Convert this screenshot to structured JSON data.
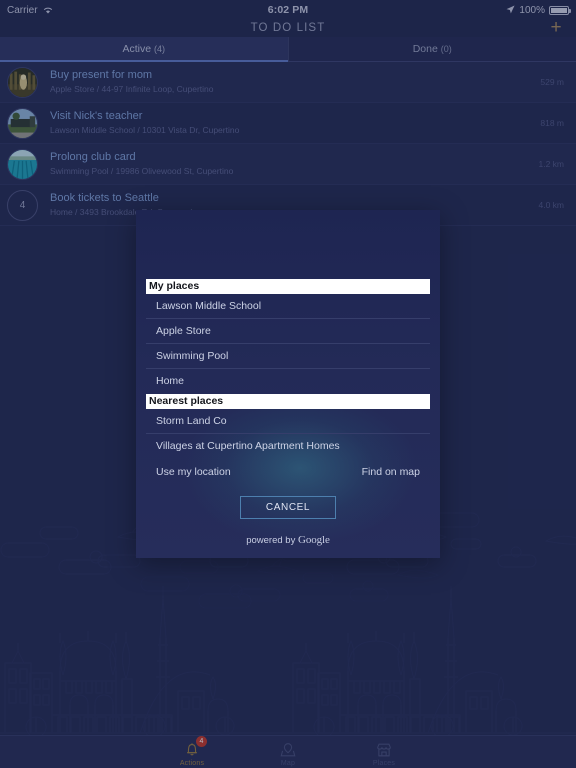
{
  "statusbar": {
    "carrier": "Carrier",
    "wifi_icon": "wifi-icon",
    "time": "6:02 PM",
    "location_icon": "location-arrow-icon",
    "battery_percent": "100%",
    "battery_icon": "battery-icon"
  },
  "navbar": {
    "title": "TO DO LIST",
    "add_label": "+"
  },
  "segments": [
    {
      "label": "Active",
      "count": "(4)",
      "selected": true
    },
    {
      "label": "Done",
      "count": "(0)",
      "selected": false
    }
  ],
  "todo_items": [
    {
      "title": "Buy present for mom",
      "subtitle": "Apple Store / 44-97 Infinite Loop, Cupertino",
      "distance": "529 m",
      "thumb": "photo-building-thumbnail"
    },
    {
      "title": "Visit Nick's teacher",
      "subtitle": "Lawson Middle School / 10301 Vista Dr, Cupertino",
      "distance": "818 m",
      "thumb": "photo-school-thumbnail"
    },
    {
      "title": "Prolong club card",
      "subtitle": "Swimming Pool / 19986 Olivewood St, Cupertino",
      "distance": "1.2 km",
      "thumb": "photo-pool-thumbnail"
    },
    {
      "title": "Book tickets to Seattle",
      "subtitle": "Home / 3493 Brookdale Rd, Sunnyvale",
      "distance": "4.0 km",
      "thumb": "number-badge",
      "number": "4"
    }
  ],
  "dialog": {
    "my_places_header": "My places",
    "my_places": [
      "Lawson Middle School",
      "Apple Store",
      "Swimming Pool",
      "Home"
    ],
    "nearest_places_header": "Nearest places",
    "nearest_places": [
      "Storm Land Co",
      "Villages at Cupertino Apartment Homes"
    ],
    "use_my_location": "Use my location",
    "find_on_map": "Find on map",
    "cancel_label": "CANCEL",
    "powered_by_prefix": "powered by ",
    "powered_by_brand": "Google"
  },
  "tabbar": [
    {
      "label": "Actions",
      "icon": "bell-icon",
      "badge": "4",
      "active": true
    },
    {
      "label": "Map",
      "icon": "map-pin-icon",
      "badge": "",
      "active": false
    },
    {
      "label": "Places",
      "icon": "store-icon",
      "badge": "",
      "active": false
    }
  ],
  "colors": {
    "background": "#232b54",
    "navbar": "#222a51",
    "accent_gold": "#a3895f",
    "link_blue": "#7f9fd6",
    "badge_red": "#c0392b",
    "section_header_bg": "#ffffff",
    "cancel_border": "#4d7fae"
  }
}
